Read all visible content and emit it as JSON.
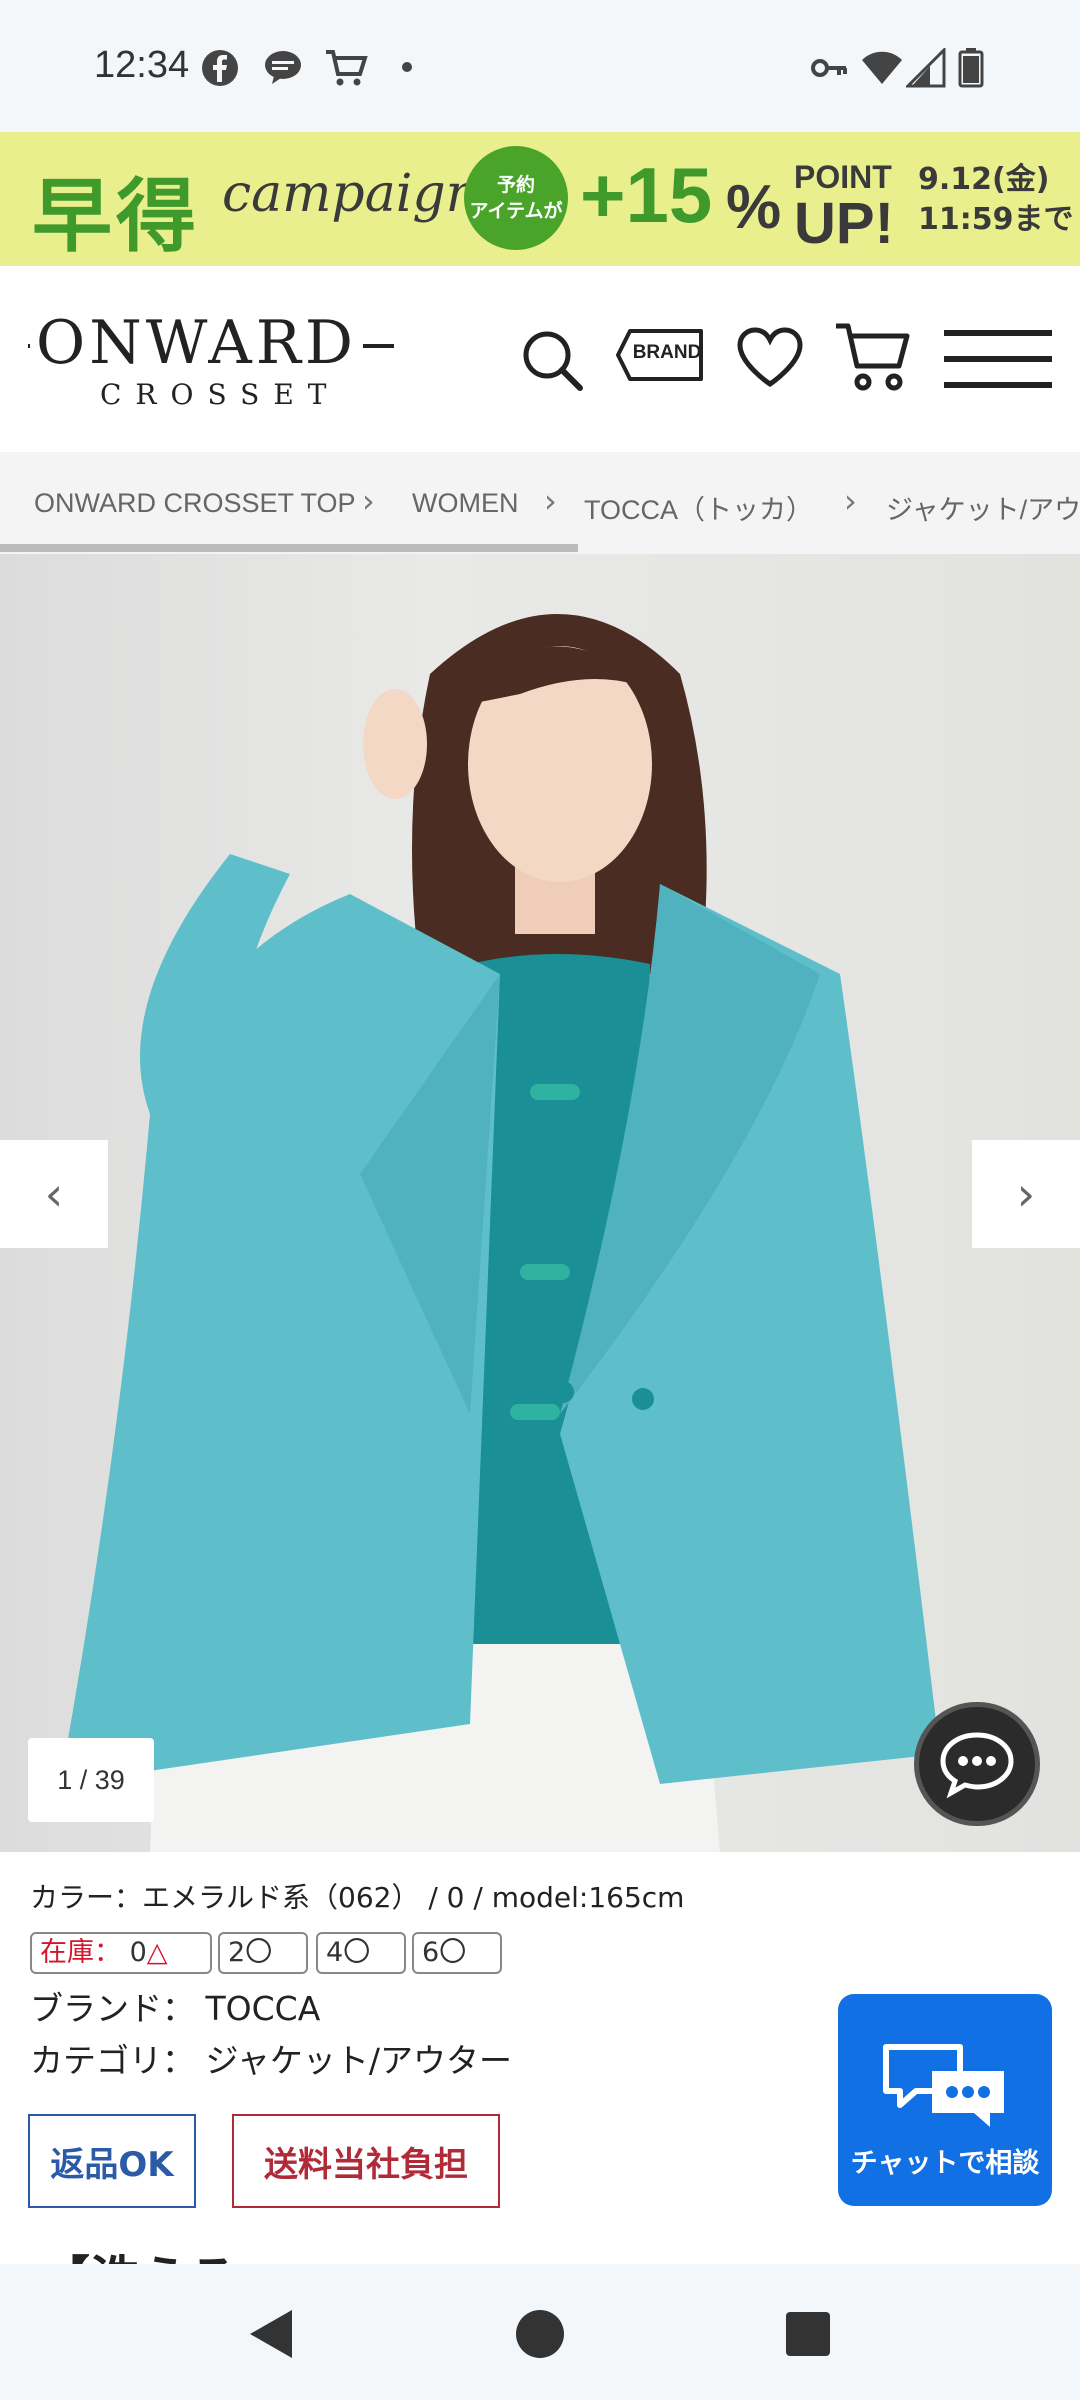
{
  "status_bar": {
    "time": "12:34"
  },
  "banner": {
    "title": "早得",
    "script": "campaign",
    "badge_line1": "予約",
    "badge_line2": "アイテムが",
    "plus": "+15",
    "percent": "%",
    "point": "POINT",
    "up": "UP!",
    "date_line1": "9.12(金)",
    "date_line2": "11:59まで",
    "bg_color": "#eaef8e",
    "accent": "#3f9a2b"
  },
  "header": {
    "logo_main": "ONWARD",
    "logo_sub": "CROSSET",
    "brand_button": "BRAND"
  },
  "breadcrumb": [
    "ONWARD CROSSET TOP",
    "WOMEN",
    "TOCCA（トッカ）",
    "ジャケット/アウ"
  ],
  "gallery": {
    "counter": "1 / 39"
  },
  "product": {
    "color_line": "カラー：エメラルド系（062）  /  0  /  model:165cm",
    "stock_label": "在庫：",
    "stock_sizes": [
      {
        "size": "0",
        "mark": "△"
      },
      {
        "size": "2",
        "mark": "〇"
      },
      {
        "size": "4",
        "mark": "〇"
      },
      {
        "size": "6",
        "mark": "〇"
      }
    ],
    "brand_line": "ブランド：  TOCCA",
    "category_line": "カテゴリ：  ジャケット/アウター",
    "tag_return": "返品OK",
    "tag_shipping": "送料当社負担",
    "chat_label": "チャットで相談",
    "cut_title": "【洗える"
  }
}
